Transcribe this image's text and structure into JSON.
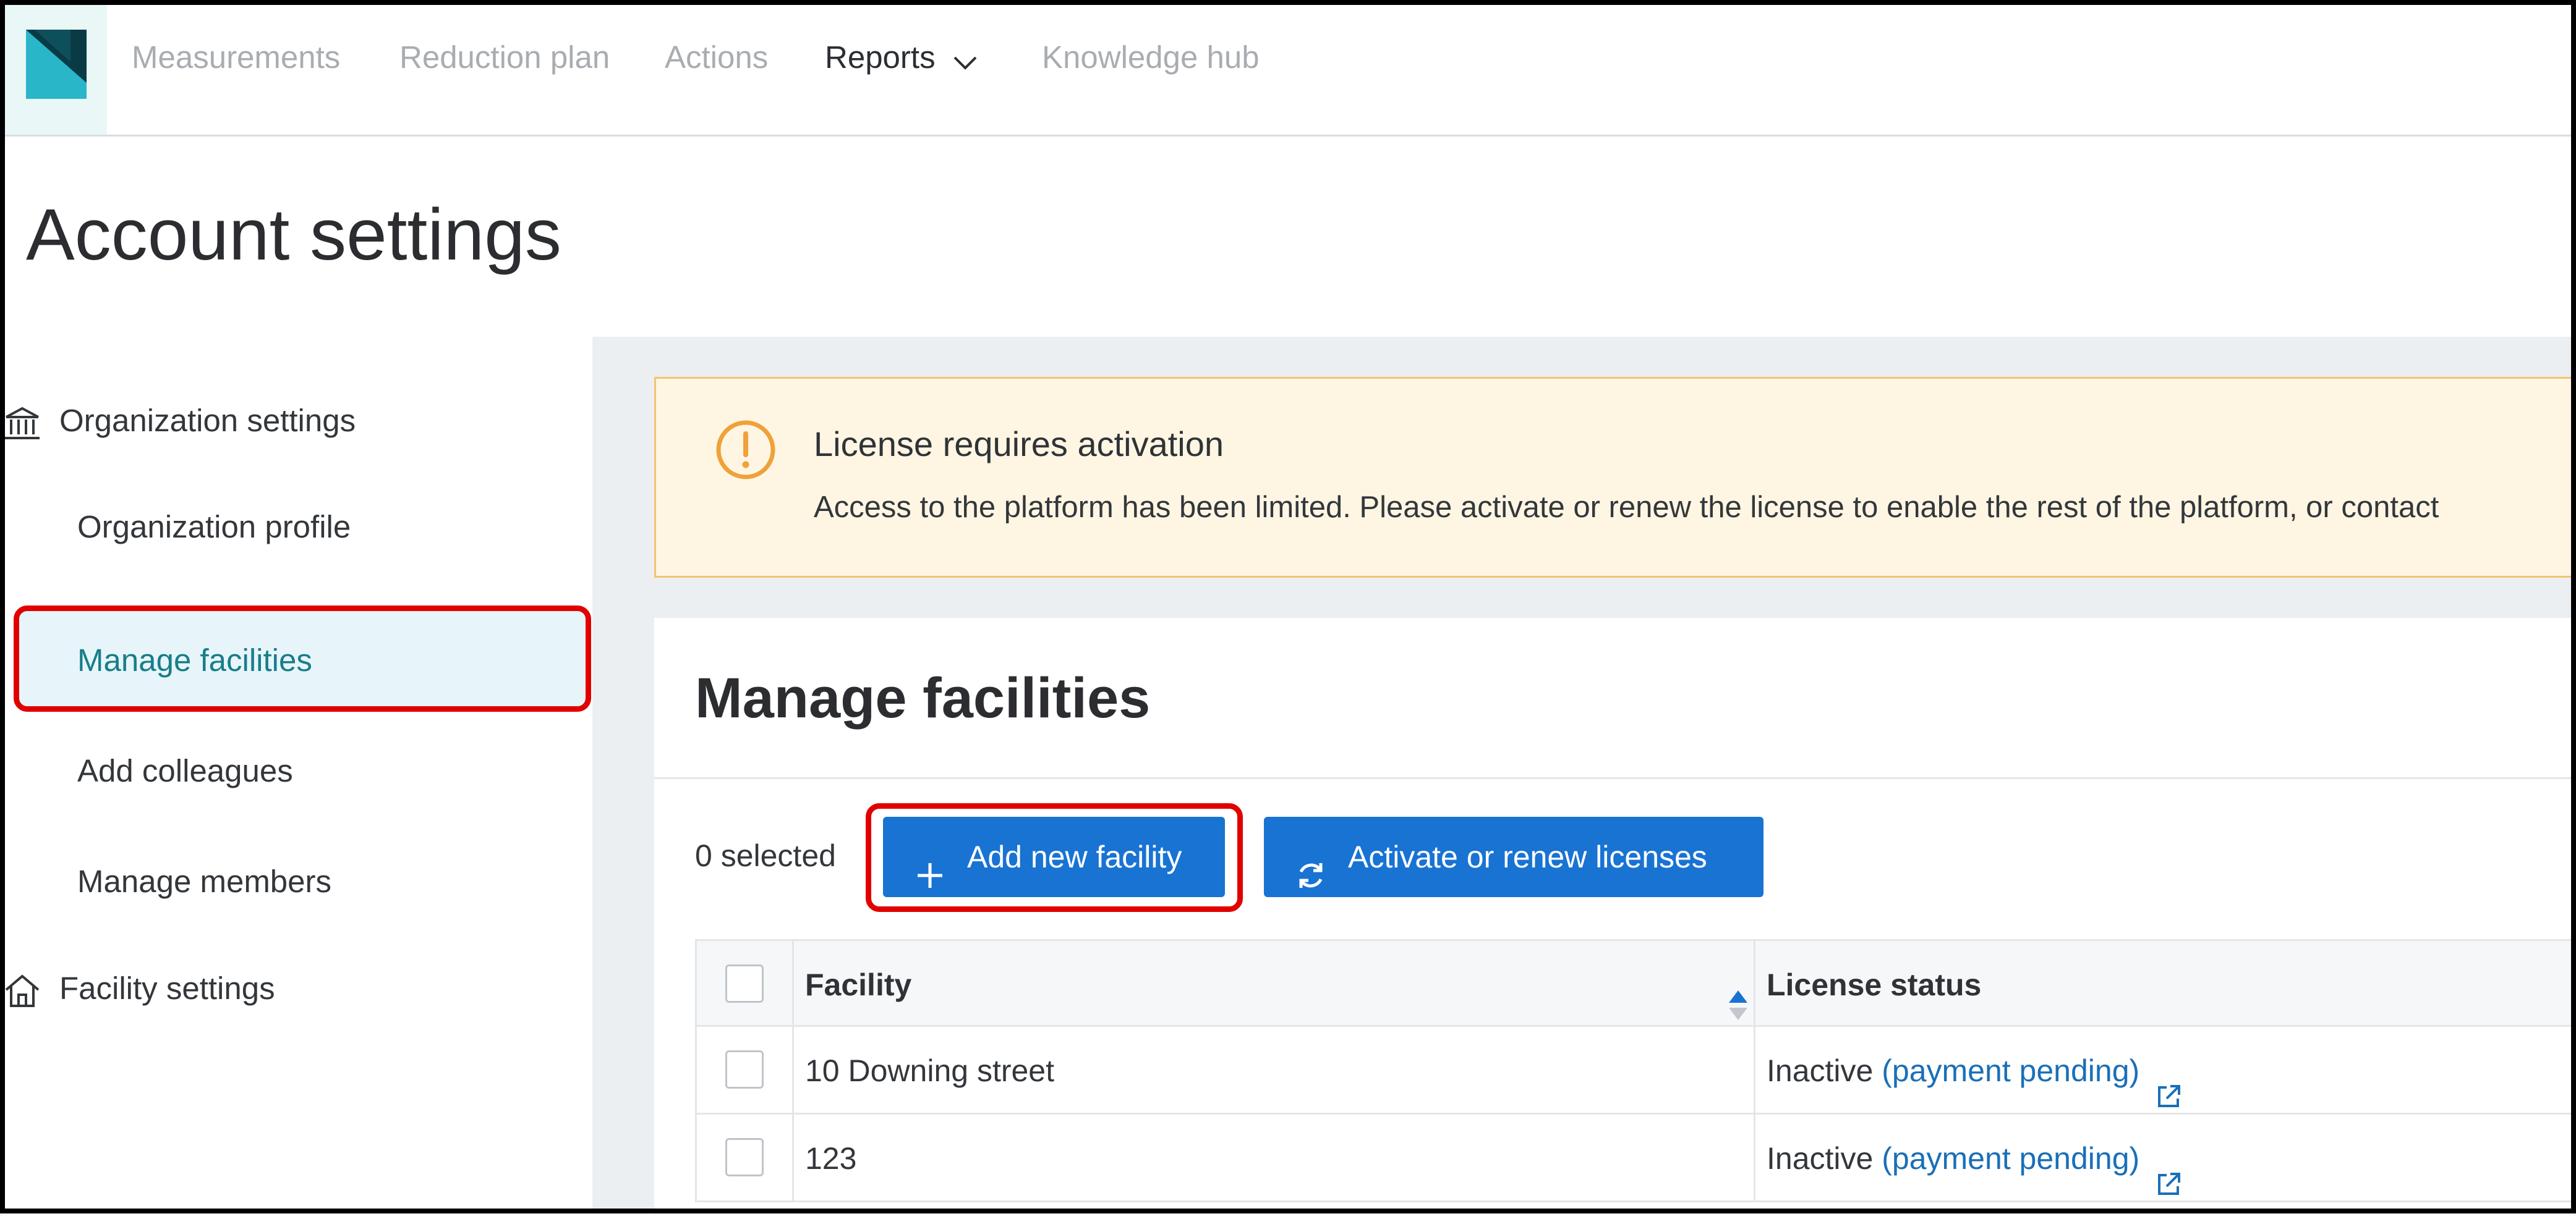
{
  "app": {
    "brand_color": "#0e4f5c",
    "accent_color": "#1873d3"
  },
  "nav": {
    "items": [
      {
        "label": "Measurements",
        "active": false
      },
      {
        "label": "Reduction plan",
        "active": false
      },
      {
        "label": "Actions",
        "active": false
      },
      {
        "label": "Reports",
        "active": true,
        "icon": "chevron-down-icon"
      },
      {
        "label": "Knowledge hub",
        "active": false
      }
    ]
  },
  "page": {
    "title": "Account settings"
  },
  "sidebar": {
    "org_heading": "Organization settings",
    "org_items": [
      "Organization profile",
      "Manage facilities",
      "Add colleagues",
      "Manage members"
    ],
    "selected": "Manage facilities",
    "facility_heading": "Facility settings"
  },
  "alert": {
    "icon": "warning-circle-icon",
    "title": "License requires activation",
    "body": "Access to the platform has been limited. Please activate or renew the license to enable the rest of the platform, or contact"
  },
  "panel": {
    "title": "Manage facilities",
    "selected_count": "0 selected",
    "add_button": "Add new facility",
    "activate_button": "Activate or renew licenses"
  },
  "table": {
    "columns": [
      "Facility",
      "License status"
    ],
    "rows": [
      {
        "facility": "10 Downing street",
        "status": "Inactive",
        "status_link": "(payment pending)"
      },
      {
        "facility": "123",
        "status": "Inactive",
        "status_link": "(payment pending)"
      }
    ]
  }
}
